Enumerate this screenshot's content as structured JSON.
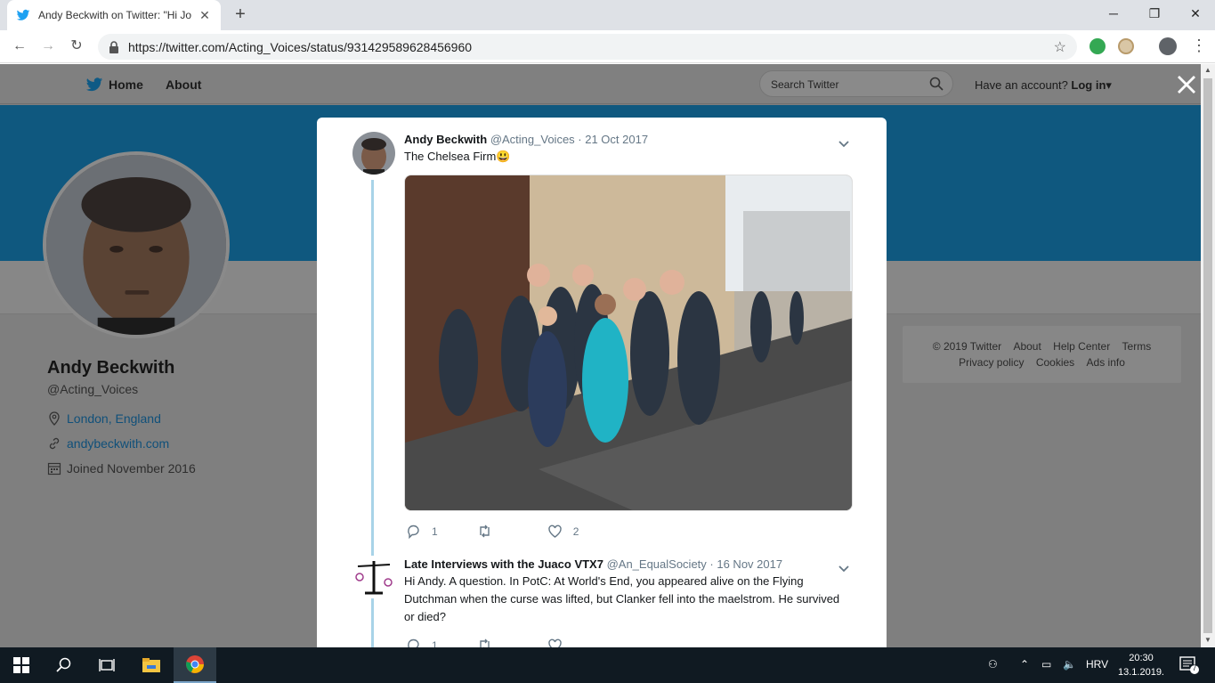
{
  "browser": {
    "tab_title": "Andy Beckwith on Twitter: \"Hi Jo",
    "url": "https://twitter.com/Acting_Voices/status/931429589628456960",
    "window_controls": [
      "─",
      "❐",
      "✕"
    ]
  },
  "nav": {
    "home": "Home",
    "about": "About",
    "search_placeholder": "Search Twitter",
    "have_account": "Have an account?",
    "login": "Log in"
  },
  "profile": {
    "name": "Andy Beckwith",
    "handle": "@Acting_Voices",
    "location": "London, England",
    "website": "andybeckwith.com",
    "joined": "Joined November 2016"
  },
  "footer": {
    "line1": [
      "© 2019 Twitter",
      "About",
      "Help Center",
      "Terms"
    ],
    "line2": [
      "Privacy policy",
      "Cookies",
      "Ads info"
    ]
  },
  "tweets": [
    {
      "name": "Andy Beckwith",
      "handle": "@Acting_Voices",
      "date": "· 21 Oct 2017",
      "text": "The Chelsea Firm😃",
      "replies": "1",
      "retweets": "",
      "likes": "2"
    },
    {
      "name": "Late Interviews with the Juaco VTX7",
      "handle": "@An_EqualSociety",
      "date": "· 16 Nov 2017",
      "text": "Hi Andy. A question. In PotC: At World's End, you appeared alive on the Flying Dutchman when the curse was lifted, but Clanker fell into the maelstrom. He survived or died?",
      "replies": "1"
    }
  ],
  "taskbar": {
    "lang": "HRV",
    "time": "20:30",
    "date": "13.1.2019.",
    "notifications": "7"
  },
  "colors": {
    "twitter_blue": "#1da1f2",
    "banner": "#0f587f",
    "overlay_gray": "#7f7f7f"
  }
}
